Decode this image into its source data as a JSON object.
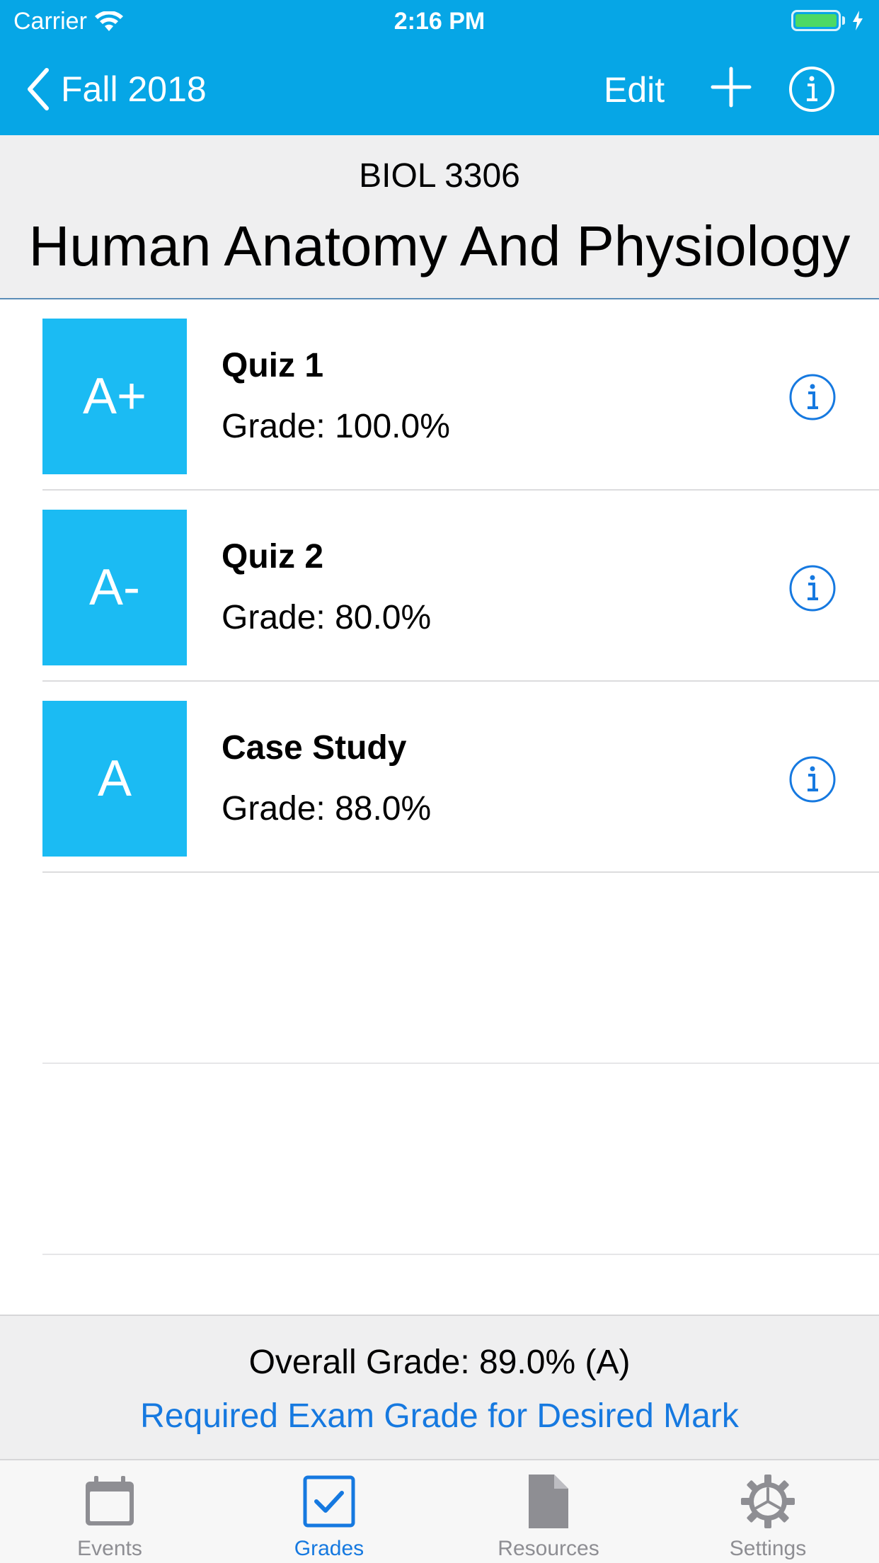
{
  "status_bar": {
    "carrier": "Carrier",
    "time": "2:16 PM",
    "battery_color": "#4CD964"
  },
  "nav": {
    "back_label": "Fall 2018",
    "edit_label": "Edit",
    "icons": [
      "chevron-left-icon",
      "plus-icon",
      "info-icon"
    ],
    "bar_color": "#06A6E6"
  },
  "course": {
    "code": "BIOL 3306",
    "name": "Human Anatomy And Physiology"
  },
  "grades": [
    {
      "letter": "A+",
      "title": "Quiz 1",
      "grade": "Grade: 100.0%"
    },
    {
      "letter": "A-",
      "title": "Quiz 2",
      "grade": "Grade: 80.0%"
    },
    {
      "letter": "A",
      "title": "Case Study",
      "grade": "Grade: 88.0%"
    }
  ],
  "footer": {
    "overall": "Overall Grade: 89.0% (A)",
    "required_link": "Required Exam Grade for Desired Mark",
    "link_color": "#1679E0"
  },
  "tabs": [
    {
      "label": "Events",
      "icon": "calendar-icon",
      "active": false
    },
    {
      "label": "Grades",
      "icon": "checkbox-icon",
      "active": true
    },
    {
      "label": "Resources",
      "icon": "document-icon",
      "active": false
    },
    {
      "label": "Settings",
      "icon": "gear-icon",
      "active": false
    }
  ],
  "colors": {
    "grade_tile": "#1BBBF3",
    "accent": "#1679E0",
    "inactive_tab": "#8E8E93"
  }
}
